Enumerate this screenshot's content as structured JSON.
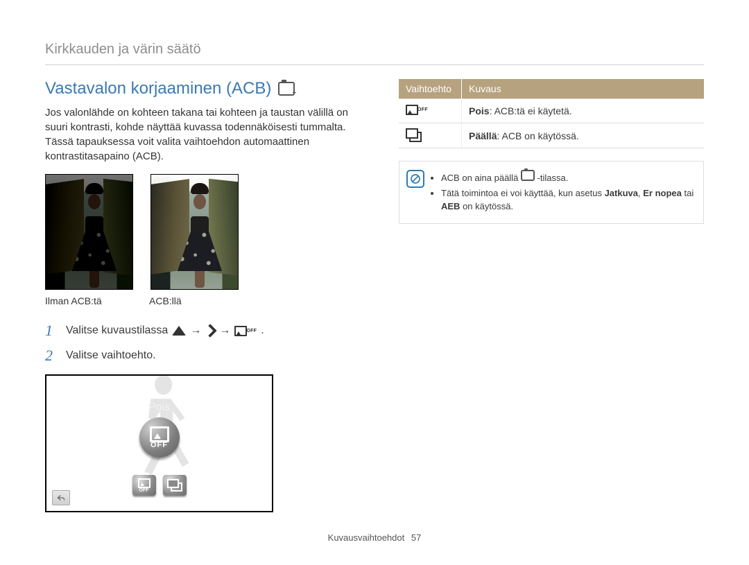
{
  "breadcrumb": "Kirkkauden ja värin säätö",
  "title": "Vastavalon korjaaminen (ACB)",
  "intro": "Jos valonlähde on kohteen takana tai kohteen ja taustan välillä on suuri kontrasti, kohde näyttää kuvassa todennäköisesti tummalta. Tässä tapauksessa voit valita vaihtoehdon automaattinen kontrastitasapaino (ACB).",
  "photo_labels": {
    "left": "Ilman ACB:tä",
    "right": "ACB:llä"
  },
  "steps": {
    "n1": "1",
    "s1a": "Valitse kuvaustilassa",
    "s1b": ".",
    "n2": "2",
    "s2": "Valitse vaihtoehto."
  },
  "lcd": {
    "label": "Pois",
    "big_off_text": "OFF",
    "thumb_off_text": "OFF"
  },
  "table": {
    "th1": "Vaihtoehto",
    "th2": "Kuvaus",
    "row_off_bold": "Pois",
    "row_off_rest": ": ACB:tä ei käytetä.",
    "row_on_bold": "Päällä",
    "row_on_rest": ": ACB on käytössä."
  },
  "note": {
    "l1a": "ACB on aina päällä ",
    "l1b": " -tilassa.",
    "l2a": "Tätä toimintoa ei voi käyttää, kun asetus ",
    "l2b": "Jatkuva",
    "l2c": ", ",
    "l2d": "Er nopea",
    "l2e": " tai ",
    "l2f": "AEB",
    "l2g": " on käytössä."
  },
  "footer": {
    "section": "Kuvausvaihtoehdot",
    "page": "57"
  }
}
